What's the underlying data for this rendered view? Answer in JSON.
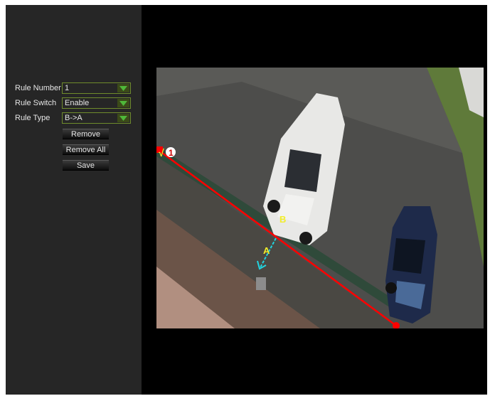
{
  "rules": {
    "rule_number": {
      "label": "Rule Number",
      "value": "1"
    },
    "rule_switch": {
      "label": "Rule Switch",
      "value": "Enable"
    },
    "rule_type": {
      "label": "Rule Type",
      "value": "B->A"
    }
  },
  "buttons": {
    "remove": "Remove",
    "remove_all": "Remove All",
    "save": "Save"
  },
  "overlay": {
    "line_index": "1",
    "check_mark": "√",
    "side_a": "A",
    "side_b": "B"
  },
  "colors": {
    "line": "#ff0000",
    "direction_arrow": "#21d4e0",
    "side_label": "#f2ee2a",
    "dropdown_arrow": "#4fb83a"
  },
  "icons": {
    "dropdown": "chevron-down-icon"
  }
}
